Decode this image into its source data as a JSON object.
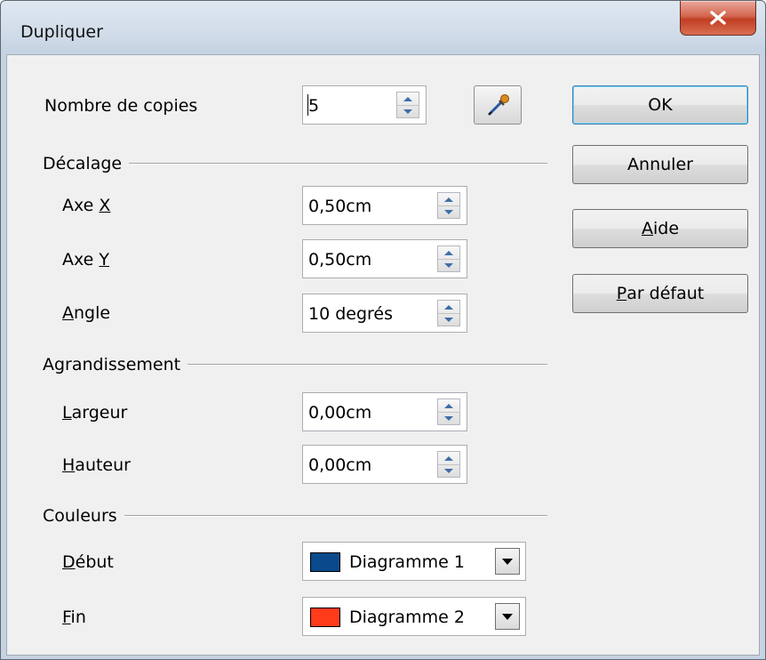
{
  "window": {
    "title": "Dupliquer",
    "close_label": "X"
  },
  "copies": {
    "label": "Nombre de copies",
    "value": "5"
  },
  "offset": {
    "section_title": "Décalage",
    "x_prefix": "Axe ",
    "x_key": "X",
    "x_value": "0,50cm",
    "y_prefix": "Axe ",
    "y_key": "Y",
    "y_value": "0,50cm",
    "angle_key": "A",
    "angle_rest": "ngle",
    "angle_value": "10 degrés"
  },
  "enlargement": {
    "section_title": "Agrandissement",
    "width_key": "L",
    "width_rest": "argeur",
    "width_value": "0,00cm",
    "height_key": "H",
    "height_rest": "auteur",
    "height_value": "0,00cm"
  },
  "colors": {
    "section_title": "Couleurs",
    "start_key": "D",
    "start_rest": "ébut",
    "start_value": "Diagramme 1",
    "start_color": "#0a4a8c",
    "end_key": "F",
    "end_rest": "in",
    "end_value": "Diagramme 2",
    "end_color": "#ff3b1a"
  },
  "buttons": {
    "ok": "OK",
    "cancel": "Annuler",
    "help_key": "A",
    "help_rest": "ide",
    "default_key": "P",
    "default_rest": "ar défaut"
  },
  "icons": {
    "pick": "eyedropper-icon",
    "close": "close-icon",
    "spin_up": "spin-up-icon",
    "spin_down": "spin-down-icon",
    "dropdown": "chevron-down-icon"
  }
}
